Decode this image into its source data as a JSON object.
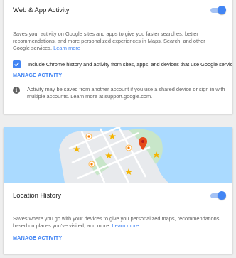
{
  "web_app_activity": {
    "title": "Web & App Activity",
    "toggle_on": true,
    "description": "Saves your activity on Google sites and apps to give you faster searches, better recommendations, and more personalized experiences in Maps, Search, and other Google services.",
    "learn_more": "Learn more",
    "checkbox_checked": true,
    "checkbox_label": "Include Chrome history and activity from sites, apps, and devices that use Google services",
    "manage_label": "MANAGE ACTIVITY",
    "info_text": "Activity may be saved from another account if you use a shared device or sign in with multiple accounts. Learn more at support.google.com."
  },
  "location_history": {
    "title": "Location History",
    "toggle_on": true,
    "description": "Saves where you go with your devices to give you personalized maps, recommendations based on places you've visited, and more.",
    "learn_more": "Learn more",
    "manage_label": "MANAGE ACTIVITY"
  },
  "colors": {
    "accent": "#4285f4",
    "map_water": "#aadaff",
    "map_park": "#c8e6c9",
    "map_road": "#ffffff",
    "pin": "#e64a19",
    "star": "#f4b400"
  },
  "icons": [
    "check-icon",
    "info-icon",
    "map-pin-icon",
    "star-icon"
  ]
}
